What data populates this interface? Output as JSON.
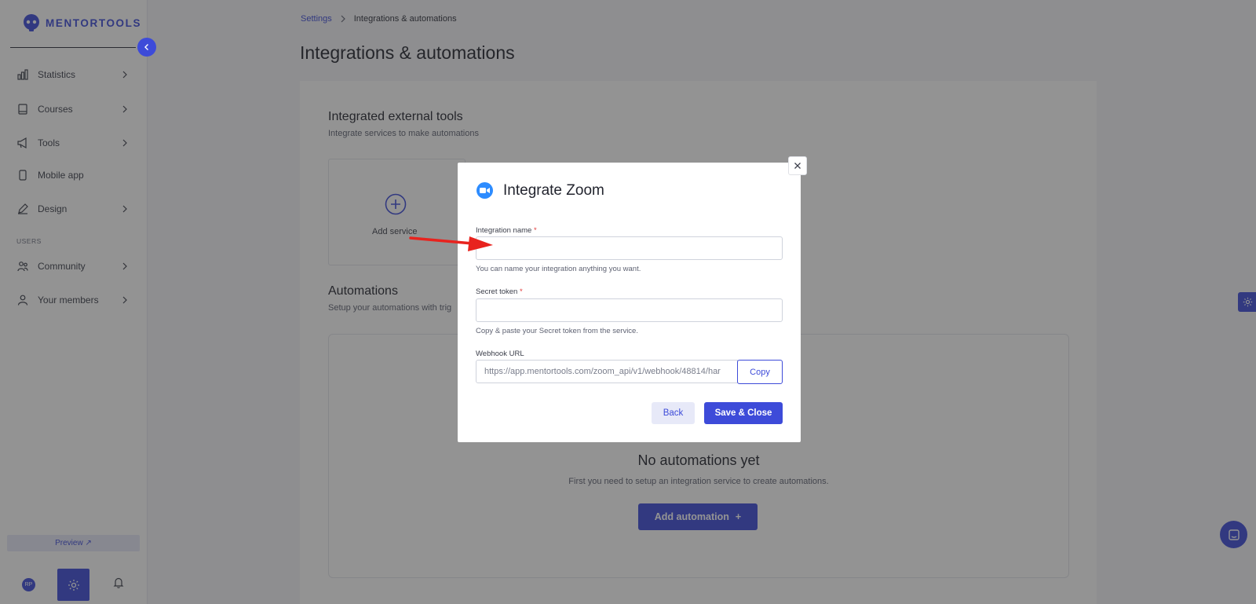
{
  "brand": {
    "name": "MENTORTOOLS",
    "accent": "#3d4bd9"
  },
  "sidebar": {
    "items": [
      {
        "label": "Statistics",
        "icon": "bar-chart-icon",
        "has_chevron": true
      },
      {
        "label": "Courses",
        "icon": "book-icon",
        "has_chevron": true
      },
      {
        "label": "Tools",
        "icon": "megaphone-icon",
        "has_chevron": true
      },
      {
        "label": "Mobile app",
        "icon": "phone-icon",
        "has_chevron": false
      },
      {
        "label": "Design",
        "icon": "pencil-icon",
        "has_chevron": true
      },
      {
        "label": "Community",
        "icon": "people-icon",
        "has_chevron": true
      },
      {
        "label": "Your members",
        "icon": "user-icon",
        "has_chevron": true
      }
    ],
    "section_users": "USERS",
    "preview_label": "Preview ↗",
    "avatar_initials": "RP"
  },
  "breadcrumb": {
    "parent": "Settings",
    "current": "Integrations & automations"
  },
  "page_title": "Integrations & automations",
  "integrations": {
    "title": "Integrated external tools",
    "subtitle": "Integrate services to make automations",
    "add_service_label": "Add service"
  },
  "automations": {
    "title": "Automations",
    "subtitle": "Setup your automations with trig",
    "empty_title": "No automations yet",
    "empty_subtitle": "First you need to setup an integration service to create automations.",
    "add_button_label": "Add automation",
    "add_button_icon": "+"
  },
  "modal": {
    "title": "Integrate Zoom",
    "fields": {
      "name": {
        "label": "Integration name",
        "required_mark": "*",
        "value": "",
        "help": "You can name your integration anything you want."
      },
      "token": {
        "label": "Secret token",
        "required_mark": "*",
        "value": "",
        "help": "Copy & paste your Secret token from the service."
      },
      "webhook": {
        "label": "Webhook URL",
        "value": "https://app.mentortools.com/zoom_api/v1/webhook/48814/har"
      }
    },
    "copy_label": "Copy",
    "back_label": "Back",
    "save_label": "Save & Close"
  }
}
